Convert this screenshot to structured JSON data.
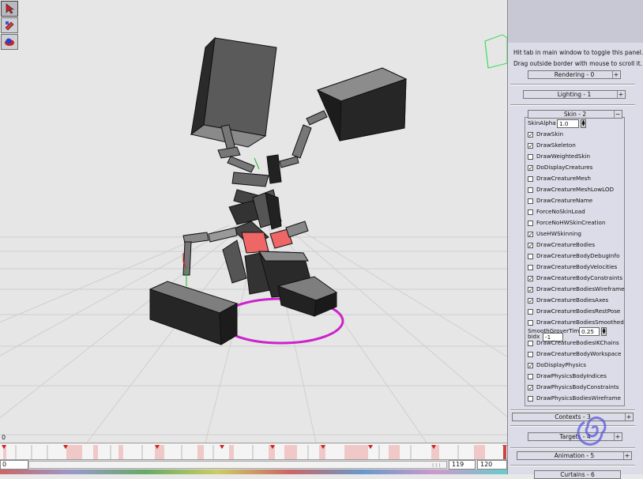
{
  "tools": [
    {
      "name": "select-arrow-icon",
      "active": true
    },
    {
      "name": "paint-tool-icon",
      "active": false
    },
    {
      "name": "physics-tool-icon",
      "active": false
    }
  ],
  "viewport": {
    "frame_zero_label": "0"
  },
  "timeline": {
    "frame_start": "0",
    "frame_current": "119",
    "frame_end": "120",
    "scroll_mark": "I I I"
  },
  "panel": {
    "hint1": "Hit tab in main window to toggle this panel.",
    "hint2": "Drag outside border with mouse to scroll it.",
    "rollouts": {
      "rendering": "Rendering - 0",
      "lighting": "Lighting - 1",
      "skin": "Skin - 2",
      "contexts": "Contexts - 3",
      "targets": "Targets - 4",
      "animation": "Animation - 5",
      "next_partial": "Curtains - 6"
    },
    "skin_alpha_label": "SkinAlpha",
    "skin_alpha_value": "1.0",
    "smooth_label": "SmoothGroverTime",
    "smooth_value": "0.25",
    "bidx_label": "bidx",
    "bidx_value": "-1",
    "options": [
      {
        "label": "DrawSkin",
        "checked": true
      },
      {
        "label": "DrawSkeleton",
        "checked": true
      },
      {
        "label": "DrawWeightedSkin",
        "checked": false
      },
      {
        "label": "DoDisplayCreatures",
        "checked": true
      },
      {
        "label": "DrawCreatureMesh",
        "checked": false
      },
      {
        "label": "DrawCreatureMeshLowLOD",
        "checked": false
      },
      {
        "label": "DrawCreatureName",
        "checked": false
      },
      {
        "label": "ForceNoSkinLoad",
        "checked": false
      },
      {
        "label": "ForceNoHWSkinCreation",
        "checked": false
      },
      {
        "label": "UseHWSkinning",
        "checked": true
      },
      {
        "label": "DrawCreatureBodies",
        "checked": true
      },
      {
        "label": "DrawCreatureBodyDebugInfo",
        "checked": false
      },
      {
        "label": "DrawCreatureBodyVelocities",
        "checked": false
      },
      {
        "label": "DrawCreatureBodyConstraints",
        "checked": true
      },
      {
        "label": "DrawCreatureBodiesWireframe",
        "checked": true
      },
      {
        "label": "DrawCreatureBodiesAxes",
        "checked": true
      },
      {
        "label": "DrawCreatureBodiesRestPose",
        "checked": false
      },
      {
        "label": "DrawCreatureBodiesSmoothed",
        "checked": false
      }
    ],
    "options2": [
      {
        "label": "DrawCreatureBodiesIKChains",
        "checked": false
      },
      {
        "label": "DrawCreatureBodyWorkspace",
        "checked": false
      },
      {
        "label": "DoDisplayPhysics",
        "checked": true
      },
      {
        "label": "DrawPhysicsBodyIndices",
        "checked": false
      },
      {
        "label": "DrawPhysicsBodyConstraints",
        "checked": true
      },
      {
        "label": "DrawPhysicsBodiesWireframe",
        "checked": false
      }
    ]
  }
}
